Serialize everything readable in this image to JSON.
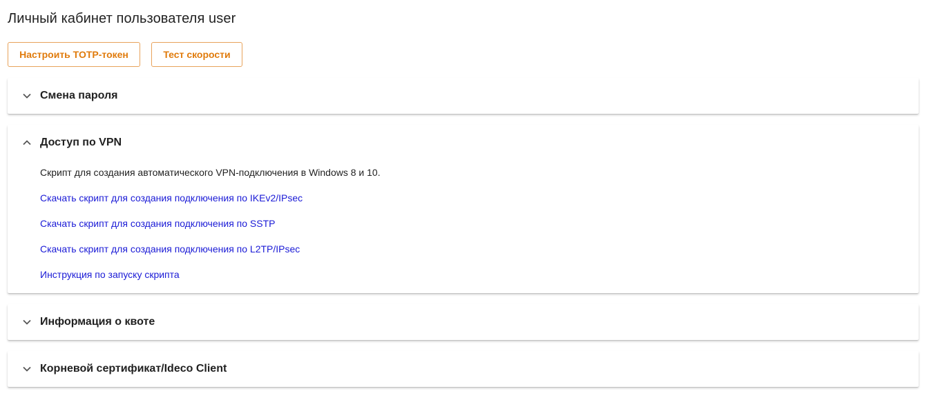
{
  "page": {
    "title": "Личный кабинет пользователя user"
  },
  "toolbar": {
    "totp_label": "Настроить TOTP-токен",
    "speed_label": "Тест скорости"
  },
  "colors": {
    "accent": "#e07b0c",
    "link": "#1a1ad6"
  },
  "panels": [
    {
      "title": "Смена пароля",
      "expanded": false,
      "icon": "chevron-down-icon"
    },
    {
      "title": "Доступ по VPN",
      "expanded": true,
      "icon": "chevron-up-icon",
      "description": "Скрипт для создания автоматического VPN-подключения в Windows 8 и 10.",
      "links": [
        "Скачать скрипт для создания подключения по IKEv2/IPsec",
        "Скачать скрипт для создания подключения по SSTP",
        "Скачать скрипт для создания подключения по L2TP/IPsec",
        "Инструкция по запуску скрипта"
      ]
    },
    {
      "title": "Информация о квоте",
      "expanded": false,
      "icon": "chevron-down-icon"
    },
    {
      "title": "Корневой сертификат/Ideco Client",
      "expanded": false,
      "icon": "chevron-down-icon"
    }
  ]
}
